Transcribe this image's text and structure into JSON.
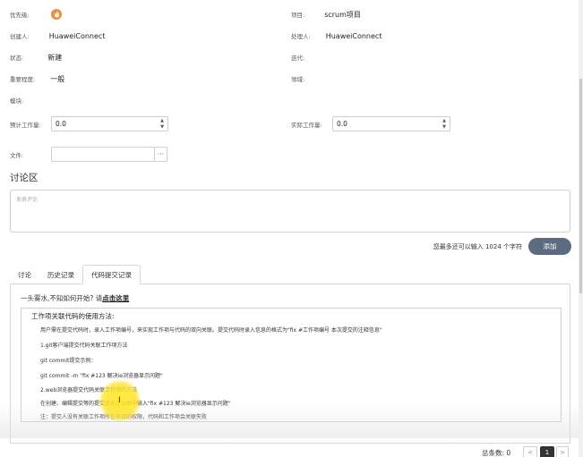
{
  "fields": {
    "priority_label": "优先级:",
    "project_label": "项目:",
    "project_value": "scrum项目",
    "creator_label": "创建人:",
    "creator_value": "HuaweiConnect",
    "handler_label": "处理人:",
    "handler_value": "HuaweiConnect",
    "status_label": "状态:",
    "status_value": "新建",
    "iteration_label": "迭代:",
    "importance_label": "重要程度:",
    "importance_value": "一般",
    "domain_label": "领域:",
    "module_label": "模块:",
    "estimated_label": "预计工作量:",
    "estimated_value": "0.0",
    "actual_label": "实际工作量:",
    "actual_value": "0.0",
    "file_label": "文件:",
    "file_browse": "···"
  },
  "discussion": {
    "title": "讨论区",
    "placeholder": "发表评论",
    "char_hint": "您最多还可以输入 1024 个字符",
    "add_button": "添加"
  },
  "tabs": [
    {
      "label": "讨论",
      "active": false
    },
    {
      "label": "历史记录",
      "active": false
    },
    {
      "label": "代码提交记录",
      "active": true
    }
  ],
  "help": {
    "prompt": "一头雾水,不知如何开始? 请",
    "link": "点击这里",
    "title": "工作项关联代码的使用方法:",
    "items": [
      "用户需在提交代码时，录入工作项编号，来实现工作项与代码的双向关联。提交代码时录入信息的格式为\"fix #工作项编号 本次提交的注释信息\"",
      "1.git客户端提交代码关联工作项方法",
      "git commit提交示例：",
      "git commit -m \"fix #123 解决ie浏览器显示问题\"",
      "2.web浏览器提交代码关联工作项的方法",
      "在创建、编辑提交等的提交信息文本框中输入\"fix #123 解决ie浏览器显示问题\"",
      "注：提交人没有关联工作项所在项目的权限，代码和工作项会关联失败"
    ]
  },
  "pager": {
    "total_label": "总条数: 0",
    "prev": "<",
    "current": "1",
    "next": ">"
  },
  "colors": {
    "priority_icon": "#f08c3c",
    "add_button": "#5c6b82",
    "cursor_highlight": "#ffe628"
  },
  "icons": {
    "priority": "flame-icon",
    "spinner_up": "chevron-up-icon",
    "spinner_down": "chevron-down-icon",
    "browse": "ellipsis-icon",
    "cursor": "text-cursor-icon"
  }
}
